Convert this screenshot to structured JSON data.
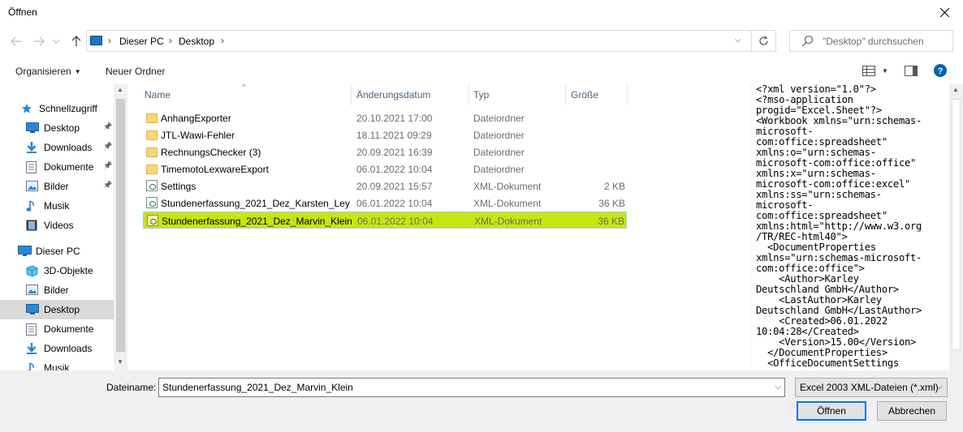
{
  "window": {
    "title": "Öffnen"
  },
  "navigation": {
    "breadcrumb": [
      "Dieser PC",
      "Desktop"
    ],
    "search_placeholder": "\"Desktop\" durchsuchen"
  },
  "commandbar": {
    "organize_label": "Organisieren",
    "new_folder_label": "Neuer Ordner"
  },
  "sidebar": {
    "items": [
      {
        "label": "Schnellzugriff",
        "icon": "star-icon"
      },
      {
        "label": "Desktop",
        "icon": "desktop-icon",
        "pinned": true
      },
      {
        "label": "Downloads",
        "icon": "download-arrow-icon",
        "pinned": true
      },
      {
        "label": "Dokumente",
        "icon": "document-icon",
        "pinned": true
      },
      {
        "label": "Bilder",
        "icon": "pictures-icon",
        "pinned": true
      },
      {
        "label": "Musik",
        "icon": "music-note-icon"
      },
      {
        "label": "Videos",
        "icon": "film-icon"
      },
      {
        "label": "Dieser PC",
        "icon": "computer-icon"
      },
      {
        "label": "3D-Objekte",
        "icon": "cube-icon"
      },
      {
        "label": "Bilder",
        "icon": "pictures-icon"
      },
      {
        "label": "Desktop",
        "icon": "desktop-icon",
        "selected": true
      },
      {
        "label": "Dokumente",
        "icon": "document-icon"
      },
      {
        "label": "Downloads",
        "icon": "download-arrow-icon"
      },
      {
        "label": "Musik",
        "icon": "music-note-icon"
      }
    ]
  },
  "filelist": {
    "columns": [
      "Name",
      "Änderungsdatum",
      "Typ",
      "Größe"
    ],
    "rows": [
      {
        "name": "AnhangExporter",
        "date": "20.10.2021 17:00",
        "type": "Dateiordner",
        "size": "",
        "icon": "folder-icon"
      },
      {
        "name": "JTL-Wawi-Fehler",
        "date": "18.11.2021 09:29",
        "type": "Dateiordner",
        "size": "",
        "icon": "folder-icon"
      },
      {
        "name": "RechnungsChecker (3)",
        "date": "20.09.2021 16:39",
        "type": "Dateiordner",
        "size": "",
        "icon": "folder-icon"
      },
      {
        "name": "TimemotoLexwareExport",
        "date": "06.01.2022 10:04",
        "type": "Dateiordner",
        "size": "",
        "icon": "folder-icon"
      },
      {
        "name": "Settings",
        "date": "20.09.2021 15:57",
        "type": "XML-Dokument",
        "size": "2 KB",
        "icon": "xml-file-icon"
      },
      {
        "name": "Stundenerfassung_2021_Dez_Karsten_Ley",
        "date": "06.01.2022 10:04",
        "type": "XML-Dokument",
        "size": "36 KB",
        "icon": "xml-file-icon"
      },
      {
        "name": "Stundenerfassung_2021_Dez_Marvin_Klein",
        "date": "06.01.2022 10:04",
        "type": "XML-Dokument",
        "size": "36 KB",
        "icon": "xml-file-icon",
        "selected": true
      }
    ]
  },
  "preview": {
    "lines": [
      "<?xml version=\"1.0\"?>",
      "<?mso-application",
      "progid=\"Excel.Sheet\"?>",
      "<Workbook xmlns=\"urn:schemas-",
      "microsoft-",
      "com:office:spreadsheet\"",
      "xmlns:o=\"urn:schemas-",
      "microsoft-com:office:office\"",
      "xmlns:x=\"urn:schemas-",
      "microsoft-com:office:excel\"",
      "xmlns:ss=\"urn:schemas-",
      "microsoft-",
      "com:office:spreadsheet\"",
      "xmlns:html=\"http://www.w3.org",
      "/TR/REC-html40\">",
      "  <DocumentProperties",
      "xmlns=\"urn:schemas-microsoft-",
      "com:office:office\">",
      "    <Author>Karley",
      "Deutschland GmbH</Author>",
      "    <LastAuthor>Karley",
      "Deutschland GmbH</LastAuthor>",
      "    <Created>06.01.2022",
      "10:04:28</Created>",
      "    <Version>15.00</Version>",
      "  </DocumentProperties>",
      "  <OfficeDocumentSettings"
    ]
  },
  "footer": {
    "filename_label": "Dateiname:",
    "filename_value": "Stundenerfassung_2021_Dez_Marvin_Klein",
    "filetype_value": "Excel 2003 XML-Dateien (*.xml)",
    "open_label": "Öffnen",
    "cancel_label": "Abbrechen"
  },
  "colors": {
    "accent": "#0078d7",
    "selection": "#c9e510"
  }
}
